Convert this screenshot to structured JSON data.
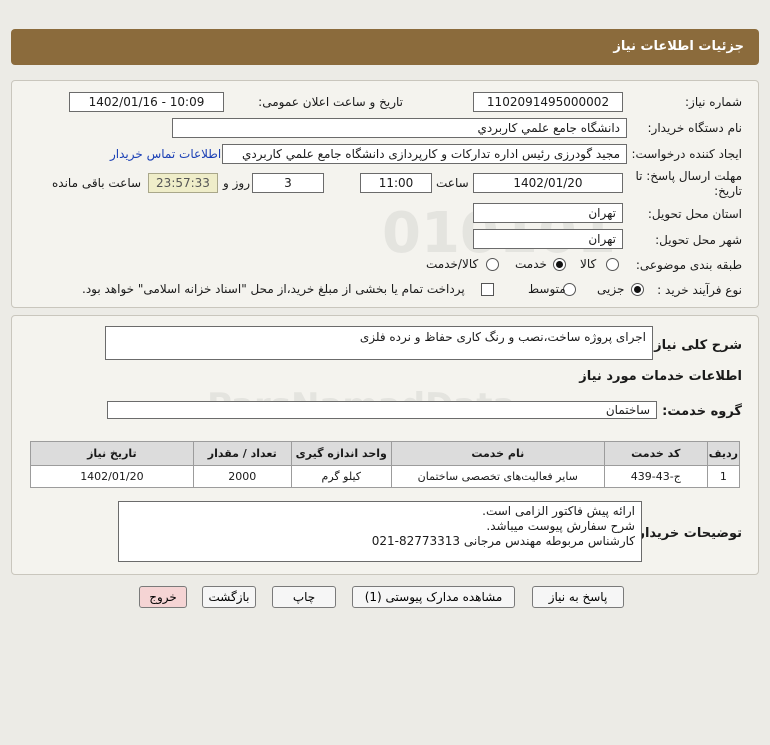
{
  "header": {
    "title": "جزئیات اطلاعات نیاز"
  },
  "info": {
    "need_number_label": "شماره نیاز:",
    "need_number": "1102091495000002",
    "announce_label": "تاریخ و ساعت اعلان عمومی:",
    "announce_value": "1402/01/16 - 10:09",
    "buyer_org_label": "نام دستگاه خریدار:",
    "buyer_org": "دانشگاه جامع علمي كاربردي",
    "creator_label": "ایجاد کننده درخواست:",
    "creator": "مجید گودرزی رئیس اداره تدارکات و کارپردازی دانشگاه جامع علمي كاربردي",
    "contact_link": "اطلاعات تماس خریدار",
    "deadline_label_1": "مهلت ارسال پاسخ: تا",
    "deadline_label_2": "تاریخ:",
    "deadline_date": "1402/01/20",
    "time_label": "ساعت",
    "deadline_time": "11:00",
    "days_value": "3",
    "days_label": "روز و",
    "remaining_time": "23:57:33",
    "remaining_label": "ساعت باقی مانده",
    "province_label": "استان محل تحویل:",
    "province": "تهران",
    "city_label": "شهر محل تحویل:",
    "city": "تهران",
    "category_label": "طبقه بندی موضوعی:",
    "category_options": [
      "کالا",
      "خدمت",
      "کالا/خدمت"
    ],
    "process_label": "نوع فرآیند خرید :",
    "process_options": [
      "جزیی",
      "متوسط"
    ],
    "payment_note": "پرداخت تمام یا بخشی از مبلغ خرید،از محل \"اسناد خزانه اسلامی\" خواهد بود."
  },
  "details": {
    "summary_label": "شرح کلی نیاز:",
    "summary": "اجرای پروژه ساخت،نصب و رنگ کاری حفاظ  و نرده فلزی",
    "services_heading": "اطلاعات خدمات مورد نیاز",
    "service_group_label": "گروه خدمت:",
    "service_group": "ساختمان",
    "table": {
      "headers": [
        "ردیف",
        "کد خدمت",
        "نام خدمت",
        "واحد اندازه گیری",
        "تعداد / مقدار",
        "تاریخ نیاز"
      ],
      "rows": [
        [
          "1",
          "ج-43-439",
          "سایر فعالیت‌های تخصصی ساختمان",
          "کیلو گرم",
          "2000",
          "1402/01/20"
        ]
      ]
    },
    "buyer_notes_label": "توضیحات خریدار:",
    "buyer_notes": [
      "ارائه پیش فاکتور الزامی است.",
      "شرح سفارش پیوست میباشد.",
      "کارشناس مربوطه مهندس مرجانی 82773313-021"
    ]
  },
  "buttons": {
    "reply": "پاسخ به نیاز",
    "attachments": "مشاهده مدارک پیوستی (1)",
    "print": "چاپ",
    "back": "بازگشت",
    "exit": "خروج"
  },
  "colors": {
    "header_bg": "#8b6b3c",
    "panel_bg": "#f4f3ee",
    "link": "#1a3fb5",
    "remaining_bg": "#efedc9",
    "exit_bg": "#f5d4d4"
  }
}
